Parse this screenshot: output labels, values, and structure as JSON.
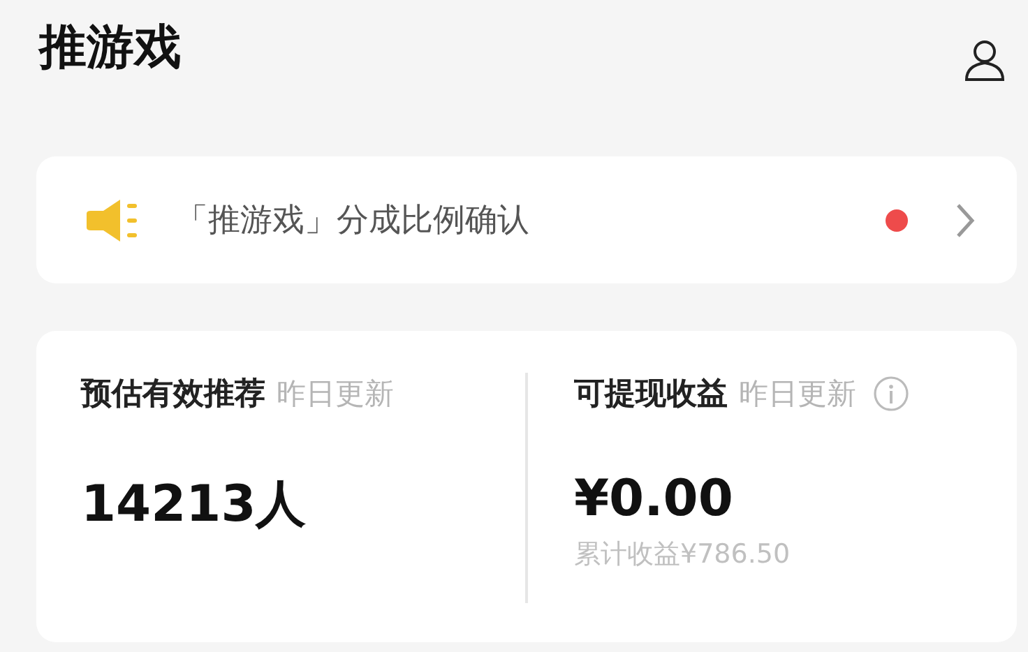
{
  "header": {
    "title": "推游戏"
  },
  "notice": {
    "text": "「推游戏」分成比例确认",
    "unread": true
  },
  "stats": [
    {
      "label": "预估有效推荐",
      "note": "昨日更新",
      "value": "14213人",
      "info": false
    },
    {
      "label": "可提现收益",
      "note": "昨日更新",
      "value": "¥0.00",
      "info": true,
      "sub": "累计收益¥786.50"
    }
  ]
}
